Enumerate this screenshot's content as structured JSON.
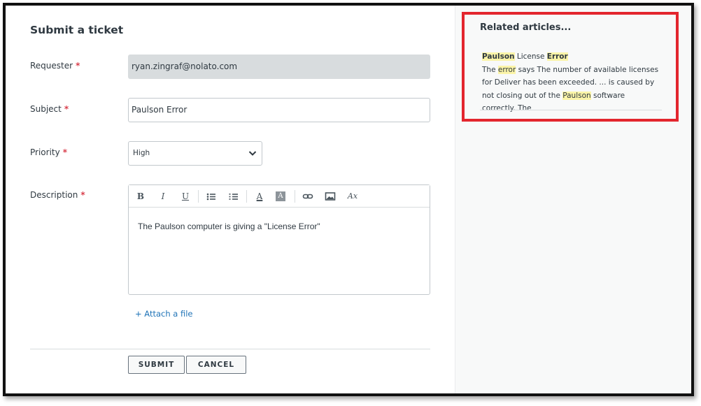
{
  "form": {
    "title": "Submit a ticket",
    "required_marker": "*",
    "requester": {
      "label": "Requester",
      "value": "ryan.zingraf@nolato.com"
    },
    "subject": {
      "label": "Subject",
      "value": "Paulson Error"
    },
    "priority": {
      "label": "Priority",
      "value": "High"
    },
    "description": {
      "label": "Description",
      "text": "The Paulson computer is giving a \"License Error\"",
      "toolbar": {
        "bold": "B",
        "italic": "I",
        "underline": "U",
        "font_color": "A",
        "bg_color": "A",
        "clear_format": "Ax",
        "icons": [
          "bulleted-list-icon",
          "numbered-list-icon",
          "link-icon",
          "image-icon"
        ]
      }
    },
    "attach_label": "+ Attach a file",
    "submit_label": "SUBMIT",
    "cancel_label": "CANCEL"
  },
  "related": {
    "title": "Related articles...",
    "article": {
      "title_part1": "Paulson",
      "title_part2": " License ",
      "title_part3": "Error",
      "excerpt_1": "The ",
      "excerpt_hl_1": "error",
      "excerpt_2": " says The number of available licenses for Deliver has been exceeded. ... is caused by not closing out of the ",
      "excerpt_hl_2": "Paulson",
      "excerpt_3": " software correctly.  The"
    },
    "highlight_color": "#fbf4a8",
    "annotation_color": "#e3262e"
  }
}
